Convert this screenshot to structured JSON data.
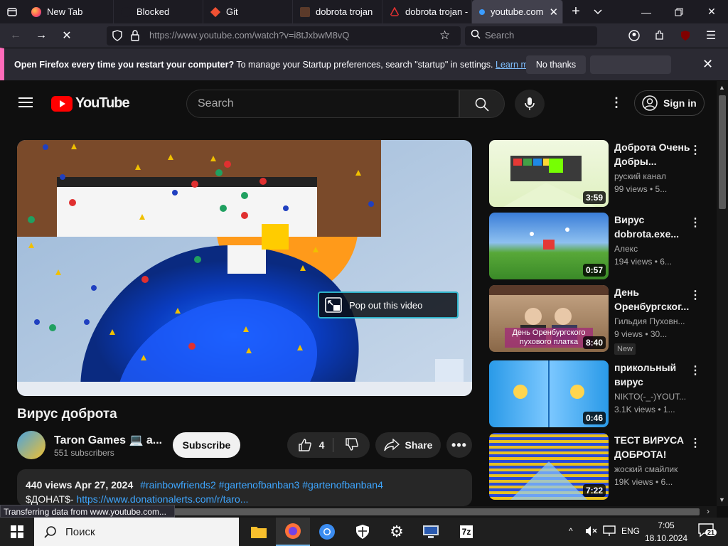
{
  "browser": {
    "tabs": [
      {
        "label": "New Tab"
      },
      {
        "label": "Blocked"
      },
      {
        "label": "Git"
      },
      {
        "label": "dobrota trojan"
      },
      {
        "label": "dobrota trojan -"
      },
      {
        "label": "youtube.com"
      }
    ],
    "url": "https://www.youtube.com/watch?v=i8tJxbwM8vQ",
    "search_placeholder": "Search",
    "status_text": "Transferring data from www.youtube.com..."
  },
  "notification": {
    "bold": "Open Firefox every time you restart your computer?",
    "text": " To manage your Startup preferences, search \"startup\" in settings.",
    "link": "Learn more",
    "no_thanks": "No thanks"
  },
  "youtube": {
    "logo_text": "YouTube",
    "search_placeholder": "Search",
    "signin": "Sign in",
    "player": {
      "popout": "Pop out this video"
    },
    "video": {
      "title": "Вирус доброта",
      "channel": "Taron Games 💻 a...",
      "subscribers": "551 subscribers",
      "subscribe": "Subscribe",
      "likes": "4",
      "share": "Share",
      "views_date": "440 views  Apr 27, 2024",
      "hashtags": "#rainbowfriends2 #gartenofbanban3 #gartenofbanban4",
      "desc_prefix": "$ДОНАТ$- ",
      "desc_link": "https://www.donationalerts.com/r/taro..."
    },
    "recommendations": [
      {
        "title": "Доброта Очень Добры...",
        "channel": "руский канал",
        "meta": "99 views • 5...",
        "duration": "3:59",
        "badge": ""
      },
      {
        "title": "Вирус dobrota.exe...",
        "channel": "Алекс",
        "meta": "194 views • 6...",
        "duration": "0:57",
        "badge": ""
      },
      {
        "title": "День Оренбургског...",
        "channel": "Гильдия Пуховн...",
        "meta": "9 views • 30...",
        "duration": "8:40",
        "badge": "New",
        "thumb_caption": "День Оренбургского пухового платка"
      },
      {
        "title": "прикольный вирус",
        "channel": "NIKTO(-_-)YOUT...",
        "meta": "3.1K views • 1...",
        "duration": "0:46",
        "badge": ""
      },
      {
        "title": "ТЕСТ ВИРУСА ДОБРОТА!",
        "channel": "жоский смайлик",
        "meta": "19K views • 6...",
        "duration": "7:22",
        "badge": ""
      }
    ]
  },
  "taskbar": {
    "search": "Поиск",
    "lang": "ENG",
    "time": "7:05",
    "date": "18.10.2024",
    "notifications": "21"
  }
}
